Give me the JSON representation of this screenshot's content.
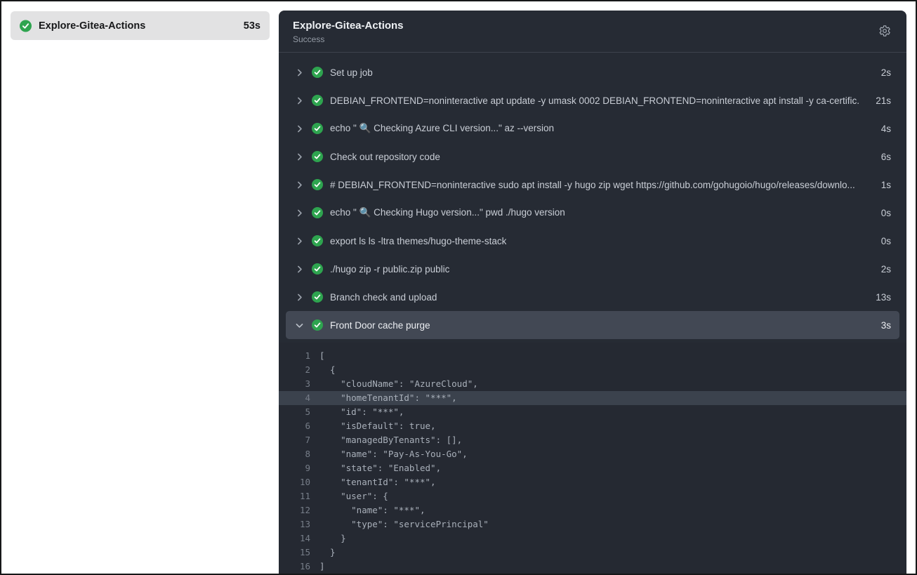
{
  "colors": {
    "accent_green": "#2ea44f",
    "panel_bg": "#262b34",
    "expanded_row_bg": "#424854",
    "highlight_line_bg": "#3b424d",
    "sidebar_item_bg": "#e2e2e3"
  },
  "icons": {
    "job_status": "check-circle-icon",
    "settings": "gear-icon",
    "collapsed": "chevron-right-icon",
    "expanded": "chevron-down-icon"
  },
  "sidebar": {
    "job": {
      "name": "Explore-Gitea-Actions",
      "duration": "53s",
      "status": "success"
    }
  },
  "panel": {
    "title": "Explore-Gitea-Actions",
    "status_text": "Success",
    "steps": [
      {
        "name": "Set up job",
        "duration": "2s",
        "expanded": false
      },
      {
        "name": "DEBIAN_FRONTEND=noninteractive apt update -y umask 0002 DEBIAN_FRONTEND=noninteractive apt install -y ca-certific...",
        "duration": "21s",
        "expanded": false
      },
      {
        "name": "echo \" 🔍 Checking Azure CLI version...\" az --version",
        "duration": "4s",
        "expanded": false
      },
      {
        "name": "Check out repository code",
        "duration": "6s",
        "expanded": false
      },
      {
        "name": "# DEBIAN_FRONTEND=noninteractive sudo apt install -y hugo zip wget https://github.com/gohugoio/hugo/releases/downlo...",
        "duration": "1s",
        "expanded": false
      },
      {
        "name": "echo \" 🔍 Checking Hugo version...\" pwd ./hugo version",
        "duration": "0s",
        "expanded": false
      },
      {
        "name": "export ls ls -ltra themes/hugo-theme-stack",
        "duration": "0s",
        "expanded": false
      },
      {
        "name": "./hugo zip -r public.zip public",
        "duration": "2s",
        "expanded": false
      },
      {
        "name": "Branch check and upload",
        "duration": "13s",
        "expanded": false
      },
      {
        "name": "Front Door cache purge",
        "duration": "3s",
        "expanded": true
      }
    ],
    "log": {
      "lines": [
        {
          "num": "1",
          "text": "[",
          "highlighted": false
        },
        {
          "num": "2",
          "text": "  {",
          "highlighted": false
        },
        {
          "num": "3",
          "text": "    \"cloudName\": \"AzureCloud\",",
          "highlighted": false
        },
        {
          "num": "4",
          "text": "    \"homeTenantId\": \"***\",",
          "highlighted": true
        },
        {
          "num": "5",
          "text": "    \"id\": \"***\",",
          "highlighted": false
        },
        {
          "num": "6",
          "text": "    \"isDefault\": true,",
          "highlighted": false
        },
        {
          "num": "7",
          "text": "    \"managedByTenants\": [],",
          "highlighted": false
        },
        {
          "num": "8",
          "text": "    \"name\": \"Pay-As-You-Go\",",
          "highlighted": false
        },
        {
          "num": "9",
          "text": "    \"state\": \"Enabled\",",
          "highlighted": false
        },
        {
          "num": "10",
          "text": "    \"tenantId\": \"***\",",
          "highlighted": false
        },
        {
          "num": "11",
          "text": "    \"user\": {",
          "highlighted": false
        },
        {
          "num": "12",
          "text": "      \"name\": \"***\",",
          "highlighted": false
        },
        {
          "num": "13",
          "text": "      \"type\": \"servicePrincipal\"",
          "highlighted": false
        },
        {
          "num": "14",
          "text": "    }",
          "highlighted": false
        },
        {
          "num": "15",
          "text": "  }",
          "highlighted": false
        },
        {
          "num": "16",
          "text": "]",
          "highlighted": false
        }
      ]
    }
  }
}
